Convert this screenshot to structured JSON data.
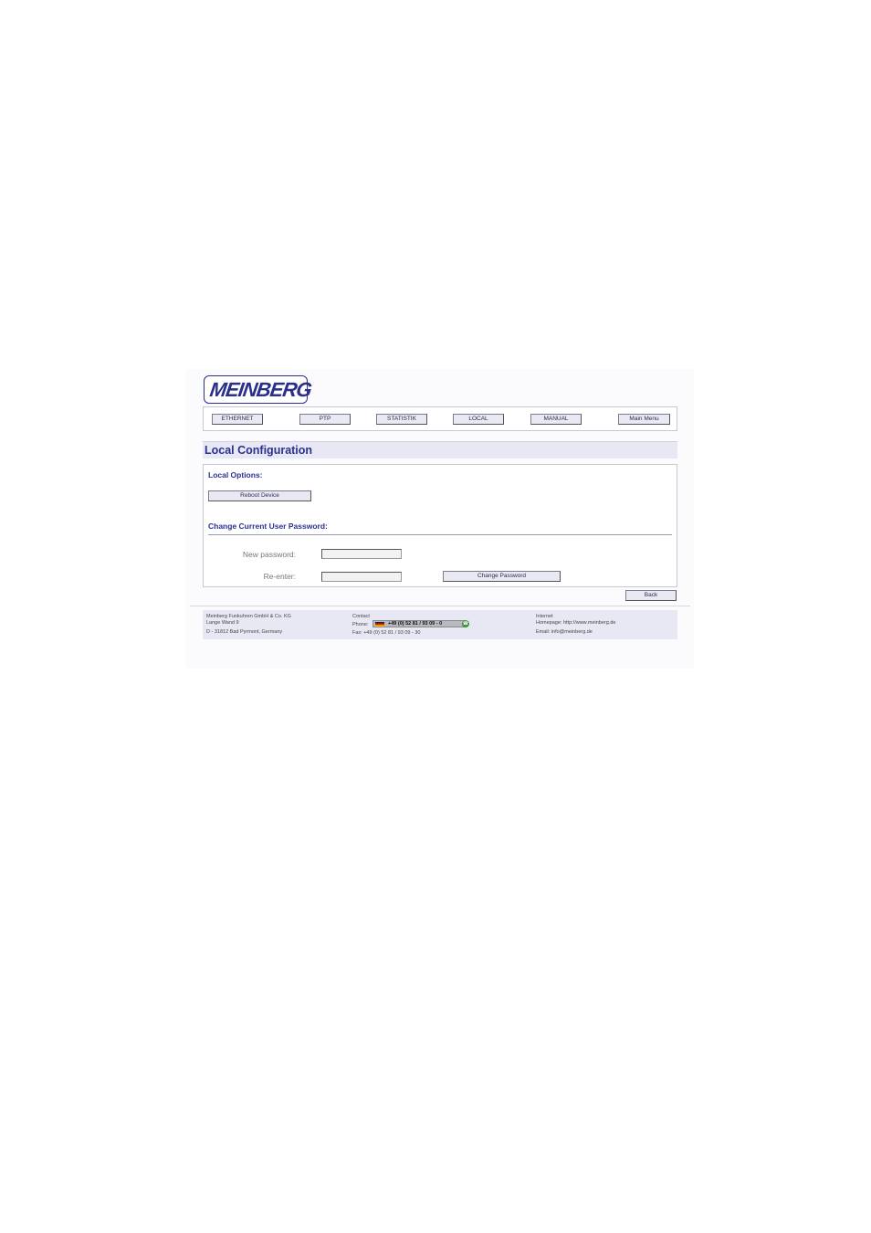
{
  "logo": {
    "text": "MEINBERG"
  },
  "nav": {
    "items": [
      "ETHERNET",
      "PTP",
      "STATISTIK",
      "LOCAL",
      "MANUAL",
      "Main Menu"
    ]
  },
  "page_title": "Local Configuration",
  "local_options": {
    "heading": "Local Options:",
    "reboot_label": "Reboot Device"
  },
  "password": {
    "heading": "Change Current User Password:",
    "new_label": "New password:",
    "reenter_label": "Re-enter:",
    "change_label": "Change Password"
  },
  "back_label": "Back",
  "footer": {
    "company": "Meinberg Funkuhren GmbH & Co. KG",
    "street": "Lange Wand 9",
    "city": "D - 31812 Bad Pyrmont, Germany",
    "contact_heading": "Contact",
    "phone_label": "Phone:",
    "phone_number": "+49 (0) 52 81 / 93 09 - 0",
    "fax": "Fax: +49 (0) 52 81 / 93 09 - 30",
    "internet_heading": "Internet",
    "homepage": "Homepage: http://www.meinberg.de",
    "email": "Email: info@meinberg.de"
  }
}
